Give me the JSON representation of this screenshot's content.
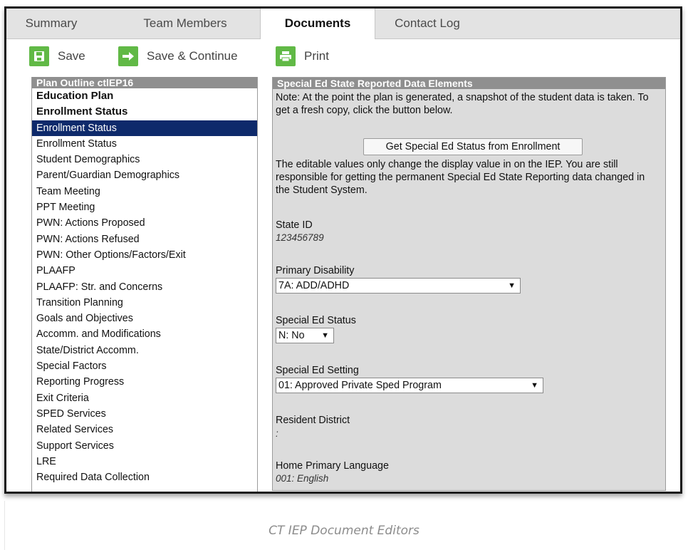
{
  "tabs": [
    {
      "label": "Summary"
    },
    {
      "label": "Team Members"
    },
    {
      "label": "Documents"
    },
    {
      "label": "Contact Log"
    }
  ],
  "active_tab": "Documents",
  "toolbar": {
    "save_label": "Save",
    "save_continue_label": "Save & Continue",
    "print_label": "Print"
  },
  "outline": {
    "title": "Plan Outline ctlEP16",
    "items": [
      {
        "label": "Education Plan"
      },
      {
        "label": "Enrollment Status"
      },
      {
        "label": "Enrollment Status"
      },
      {
        "label": "Enrollment Status"
      },
      {
        "label": "Student Demographics"
      },
      {
        "label": "Parent/Guardian Demographics"
      },
      {
        "label": "Team Meeting"
      },
      {
        "label": "PPT Meeting"
      },
      {
        "label": "PWN: Actions Proposed"
      },
      {
        "label": "PWN: Actions Refused"
      },
      {
        "label": "PWN: Other Options/Factors/Exit"
      },
      {
        "label": "PLAAFP"
      },
      {
        "label": "PLAAFP: Str. and Concerns"
      },
      {
        "label": "Transition Planning"
      },
      {
        "label": "Goals and Objectives"
      },
      {
        "label": "Accomm. and Modifications"
      },
      {
        "label": "State/District Accomm."
      },
      {
        "label": "Special Factors"
      },
      {
        "label": "Reporting Progress"
      },
      {
        "label": "Exit Criteria"
      },
      {
        "label": "SPED Services"
      },
      {
        "label": "Related Services"
      },
      {
        "label": "Support Services"
      },
      {
        "label": "LRE"
      },
      {
        "label": "Required Data Collection"
      }
    ]
  },
  "panel": {
    "title": "Special Ed State Reported Data Elements",
    "note": "Note: At the point the plan is generated, a snapshot of the student data is taken. To get a fresh copy, click the button below.",
    "button_label": "Get Special Ed Status from Enrollment",
    "editable_note": "The editable values only change the display value in on the IEP. You are still responsible for getting the permanent Special Ed State Reporting data changed in the Student System.",
    "state_id_label": "State ID",
    "state_id_value": "123456789",
    "primary_disability_label": "Primary Disability",
    "primary_disability_value": "7A: ADD/ADHD",
    "sped_status_label": "Special Ed Status",
    "sped_status_value": "N: No",
    "sped_setting_label": "Special Ed Setting",
    "sped_setting_value": "01: Approved Private Sped Program",
    "resident_district_label": "Resident District",
    "resident_district_value": ":",
    "home_language_label": "Home Primary Language",
    "home_language_value": "001: English"
  },
  "caption": "CT IEP Document Editors",
  "colors": {
    "accent_green": "#61b946",
    "selected_bg": "#0e2a6b",
    "panel_header": "#8f8f8f"
  }
}
